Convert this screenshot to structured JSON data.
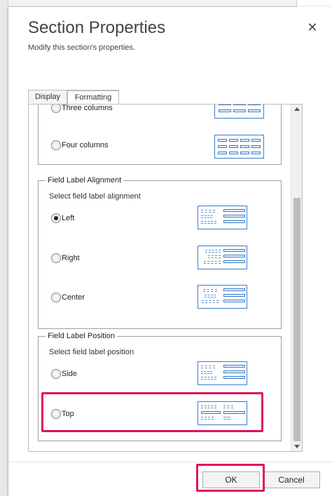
{
  "dialog": {
    "title": "Section Properties",
    "subtitle": "Modify this section's properties.",
    "close_glyph": "✕"
  },
  "tabs": [
    {
      "label": "Display"
    },
    {
      "label": "Formatting",
      "selected": true
    }
  ],
  "columns": {
    "options": [
      {
        "label": "Three columns",
        "checked": false,
        "icon": "three-columns-layout-icon"
      },
      {
        "label": "Four columns",
        "checked": false,
        "icon": "four-columns-layout-icon"
      }
    ]
  },
  "alignment": {
    "legend": "Field Label Alignment",
    "description": "Select field label alignment",
    "options": [
      {
        "label": "Left",
        "checked": true,
        "icon": "label-left-aligned-icon"
      },
      {
        "label": "Right",
        "checked": false,
        "icon": "label-right-aligned-icon"
      },
      {
        "label": "Center",
        "checked": false,
        "icon": "label-center-aligned-icon"
      }
    ]
  },
  "position": {
    "legend": "Field Label Position",
    "description": "Select field label position",
    "options": [
      {
        "label": "Side",
        "checked": false,
        "icon": "label-side-position-icon"
      },
      {
        "label": "Top",
        "checked": false,
        "icon": "label-top-position-icon"
      }
    ]
  },
  "footer": {
    "ok_label": "OK",
    "cancel_label": "Cancel"
  },
  "colors": {
    "highlight": "#e0115f",
    "preview_accent": "#3a7bc8"
  }
}
